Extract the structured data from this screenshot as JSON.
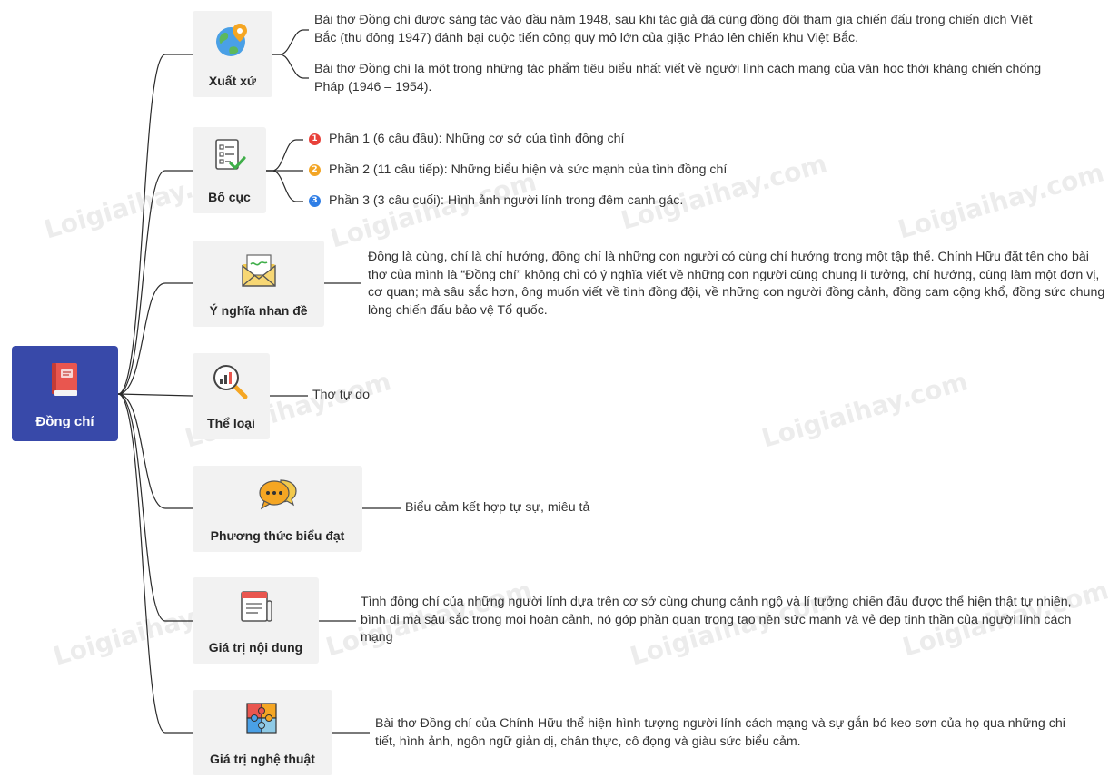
{
  "root": {
    "label": "Đồng chí",
    "icon": "book-icon"
  },
  "branches": [
    {
      "label": "Xuất xứ",
      "icon": "globe-pin-icon",
      "texts": [
        "Bài thơ Đồng chí được sáng tác vào đầu năm 1948, sau khi tác giả đã cùng đồng đội tham gia chiến đấu trong chiến dịch Việt Bắc (thu đông 1947) đánh bại cuộc tiến công quy mô lớn của giặc Pháo lên chiến khu Việt Bắc.",
        "Bài thơ Đồng chí là một trong những tác phẩm tiêu biểu nhất viết về người lính cách mạng của văn học thời kháng chiến chống Pháp (1946 – 1954)."
      ]
    },
    {
      "label": "Bố cục",
      "icon": "checklist-icon",
      "items": [
        {
          "num": "1",
          "color": "#e8413a",
          "text": "Phần 1 (6 câu đầu): Những cơ sở của tình đồng chí"
        },
        {
          "num": "2",
          "color": "#f3a525",
          "text": "Phần 2 (11 câu tiếp): Những biểu hiện và sức mạnh của tình đồng chí"
        },
        {
          "num": "3",
          "color": "#2f7ee6",
          "text": "Phần 3 (3 câu cuối): Hình ảnh người lính trong đêm canh gác."
        }
      ]
    },
    {
      "label": "Ý nghĩa nhan đề",
      "icon": "envelope-icon",
      "text": "Đồng là cùng, chí là chí hướng, đồng chí là những con người có cùng chí hướng trong một tập thể. Chính Hữu đặt tên cho bài thơ của mình là “Đồng chí” không chỉ có ý nghĩa viết về những con người cùng chung lí tưởng, chí hướng, cùng làm một đơn vị, cơ quan; mà sâu sắc hơn, ông muốn viết về tình đồng đội, về những con người đồng cảnh, đồng cam cộng khổ, đồng sức chung lòng chiến đấu bảo vệ Tổ quốc."
    },
    {
      "label": "Thể loại",
      "icon": "magnifier-chart-icon",
      "text": "Thơ tự do"
    },
    {
      "label": "Phương thức biểu đạt",
      "icon": "chat-bubbles-icon",
      "text": "Biểu cảm kết hợp tự sự, miêu tả"
    },
    {
      "label": "Giá trị nội dung",
      "icon": "newspaper-icon",
      "text": "Tình đồng chí của những người lính dựa trên cơ sở cùng chung cảnh ngộ và lí tưởng chiến đấu được thể hiện thật tự nhiên, bình dị mà sâu sắc trong mọi hoàn cảnh, nó góp phần quan trọng tạo nên sức mạnh và vẻ đẹp tinh thần của người lính cách mạng"
    },
    {
      "label": "Giá trị nghệ thuật",
      "icon": "puzzle-icon",
      "text": "Bài thơ Đồng chí của Chính Hữu thể hiện hình tượng người lính cách mạng và sự gắn bó keo sơn của họ qua những chi tiết, hình ảnh, ngôn ngữ giản dị, chân thực, cô đọng và giàu sức biểu cảm."
    }
  ],
  "watermark": "Loigiaihay.com"
}
